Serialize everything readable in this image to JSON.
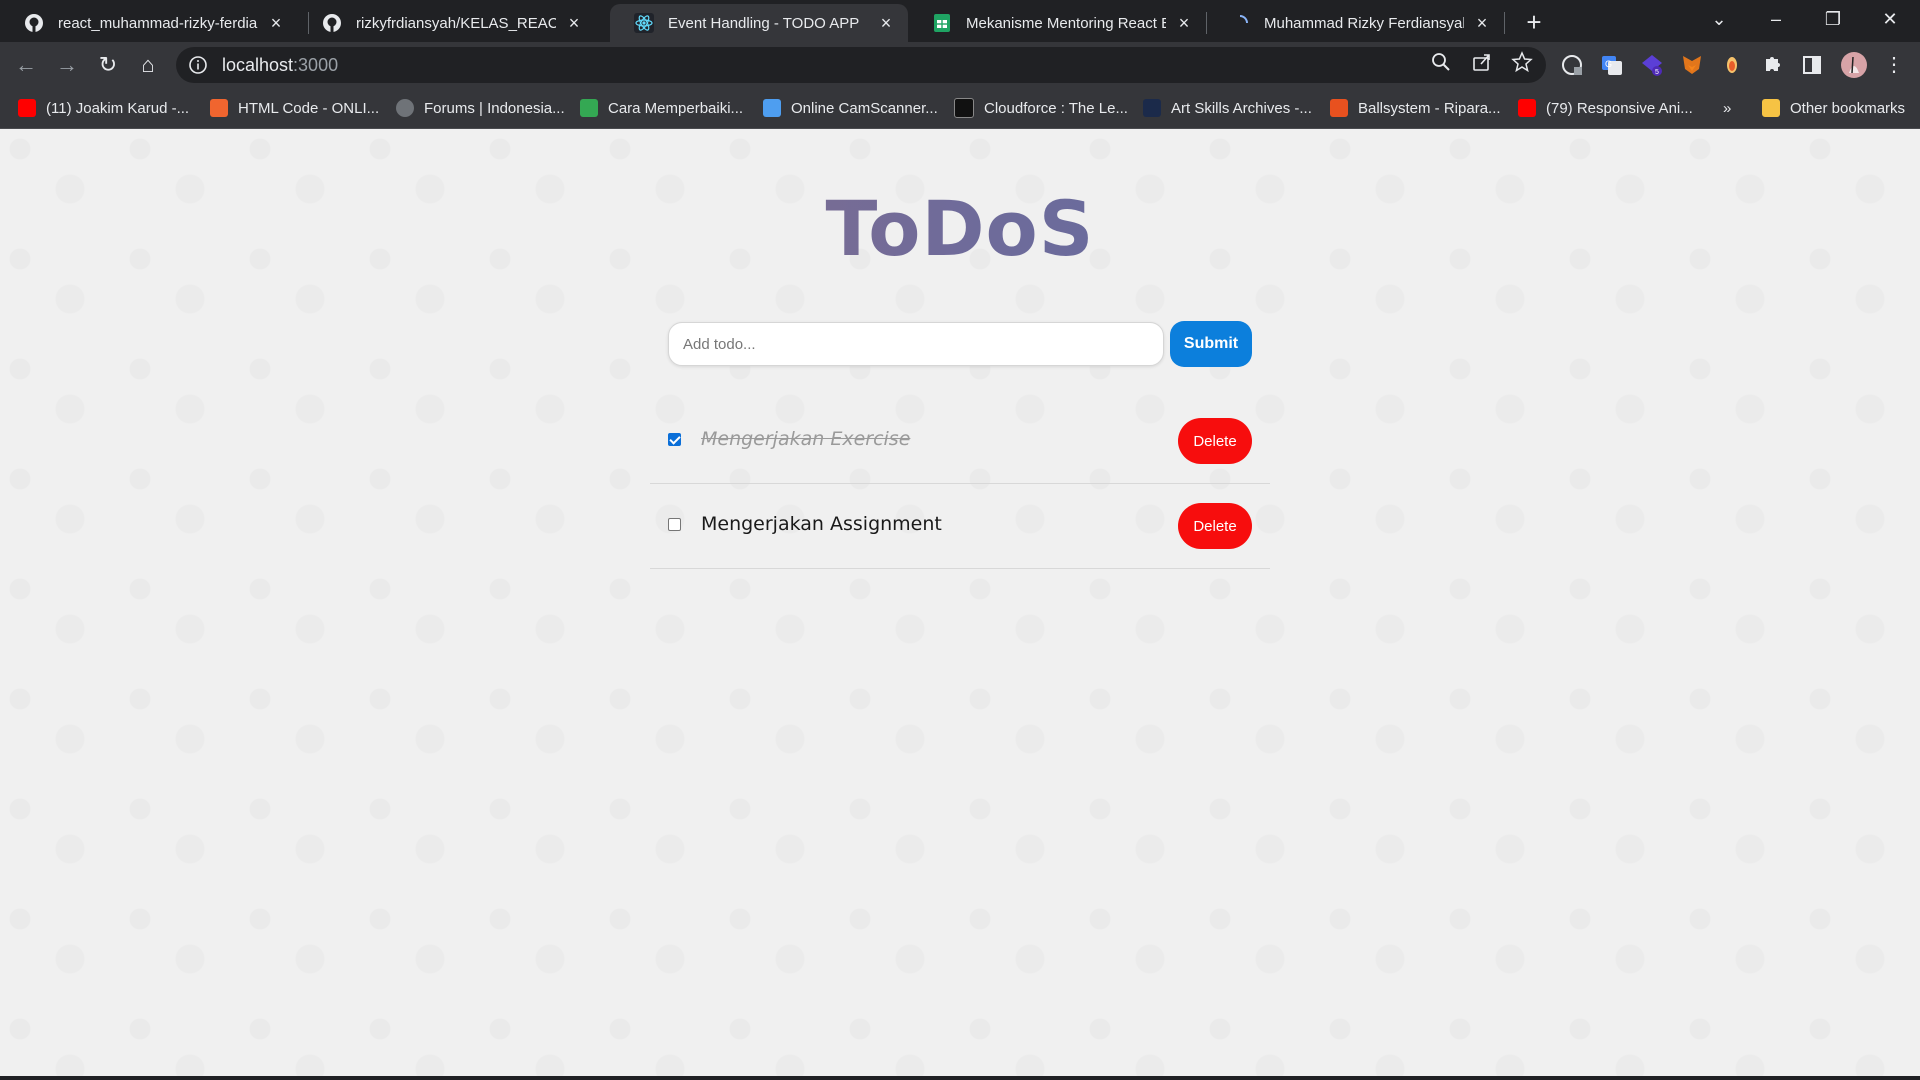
{
  "browser": {
    "tabs": [
      {
        "title": "react_muhammad-rizky-ferdiansy",
        "icon": "github-icon",
        "active": false
      },
      {
        "title": "rizkyfrdiansyah/KELAS_REACT-B:",
        "icon": "github-icon",
        "active": false
      },
      {
        "title": "Event Handling - TODO APP",
        "icon": "react-icon",
        "active": true
      },
      {
        "title": "Mekanisme Mentoring React Bat",
        "icon": "sheets-icon",
        "active": false
      },
      {
        "title": "Muhammad Rizky Ferdiansyah -",
        "icon": "loading-icon",
        "active": false
      }
    ],
    "url_host": "localhost",
    "url_port": ":3000",
    "bookmarks": [
      {
        "label": "(11) Joakim Karud -...",
        "icon": "youtube-icon"
      },
      {
        "label": "HTML Code - ONLI...",
        "icon": "html-code-icon"
      },
      {
        "label": "Forums | Indonesia...",
        "icon": "forum-icon"
      },
      {
        "label": "Cara Memperbaiki...",
        "icon": "shield-icon"
      },
      {
        "label": "Online CamScanner...",
        "icon": "camscanner-icon"
      },
      {
        "label": "Cloudforce : The Le...",
        "icon": "cloudforce-icon"
      },
      {
        "label": "Art Skills Archives -...",
        "icon": "art-icon"
      },
      {
        "label": "Ballsystem - Ripara...",
        "icon": "ballsystem-icon"
      },
      {
        "label": "(79) Responsive Ani...",
        "icon": "youtube-icon"
      }
    ],
    "overflow_label": "»",
    "other_bookmarks": "Other bookmarks"
  },
  "app": {
    "title": "ToDoS",
    "input_placeholder": "Add todo...",
    "input_value": "",
    "submit_label": "Submit",
    "todos": [
      {
        "text": "Mengerjakan Exercise",
        "completed": true,
        "delete_label": "Delete"
      },
      {
        "text": "Mengerjakan Assignment",
        "completed": false,
        "delete_label": "Delete"
      }
    ]
  },
  "colors": {
    "submit": "#0c7fdc",
    "delete": "#f70d0d",
    "title_gradient": [
      "#a56f74",
      "#4f6aa6"
    ]
  }
}
